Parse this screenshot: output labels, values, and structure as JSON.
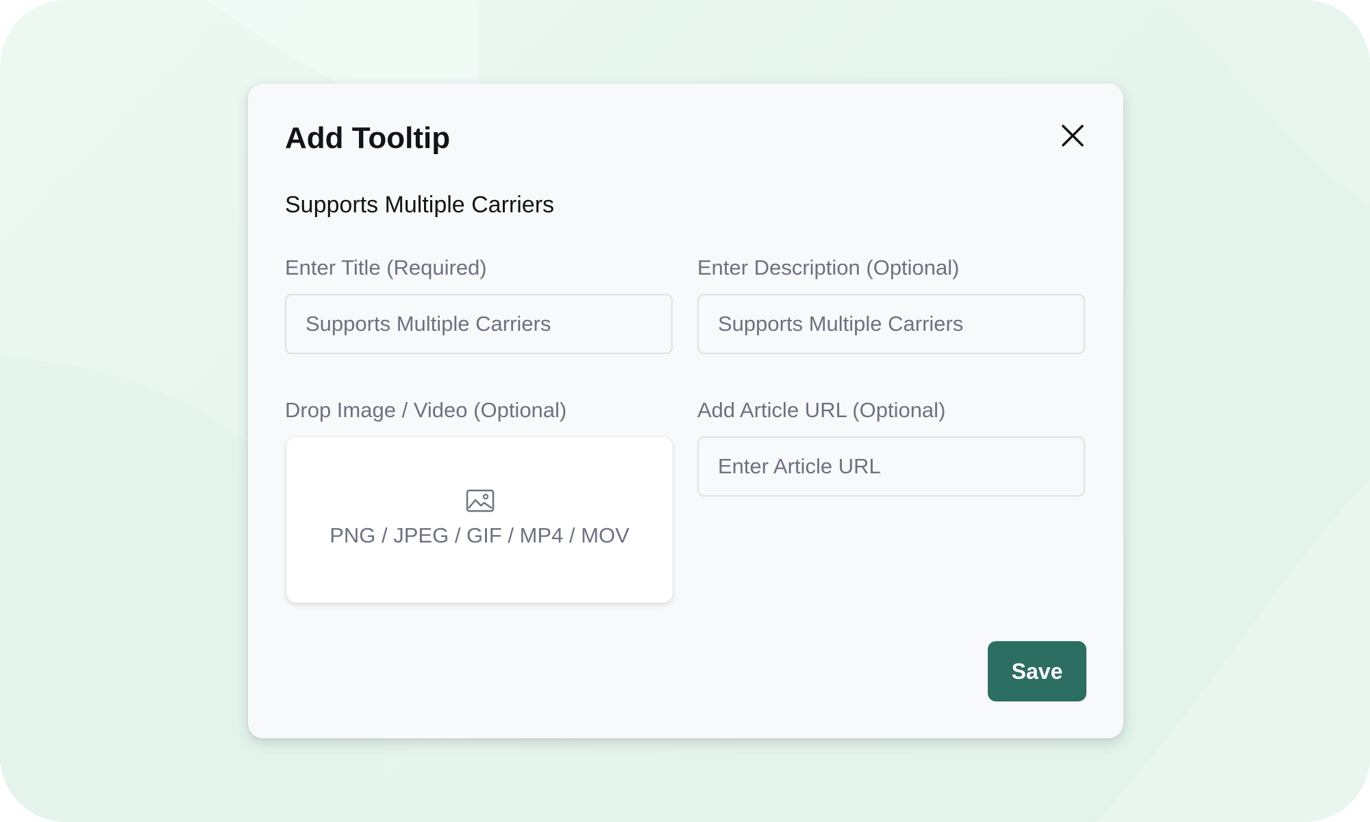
{
  "modal": {
    "title": "Add Tooltip",
    "close_icon": "close-icon",
    "section_title": "Supports Multiple Carriers"
  },
  "fields": {
    "title": {
      "label": "Enter Title (Required)",
      "value": "Supports Multiple Carriers"
    },
    "description": {
      "label": "Enter Description (Optional)",
      "value": "Supports Multiple Carriers"
    },
    "media": {
      "label": "Drop Image / Video (Optional)",
      "icon": "image-icon",
      "formats": "PNG / JPEG / GIF / MP4 / MOV"
    },
    "article_url": {
      "label": "Add Article URL (Optional)",
      "placeholder": "Enter Article URL",
      "value": ""
    }
  },
  "actions": {
    "save_label": "Save"
  },
  "colors": {
    "primary": "#2d6e62",
    "background_tint": "#e6f5ee",
    "modal_bg": "#f8f9fb",
    "muted_text": "#6b7280"
  }
}
